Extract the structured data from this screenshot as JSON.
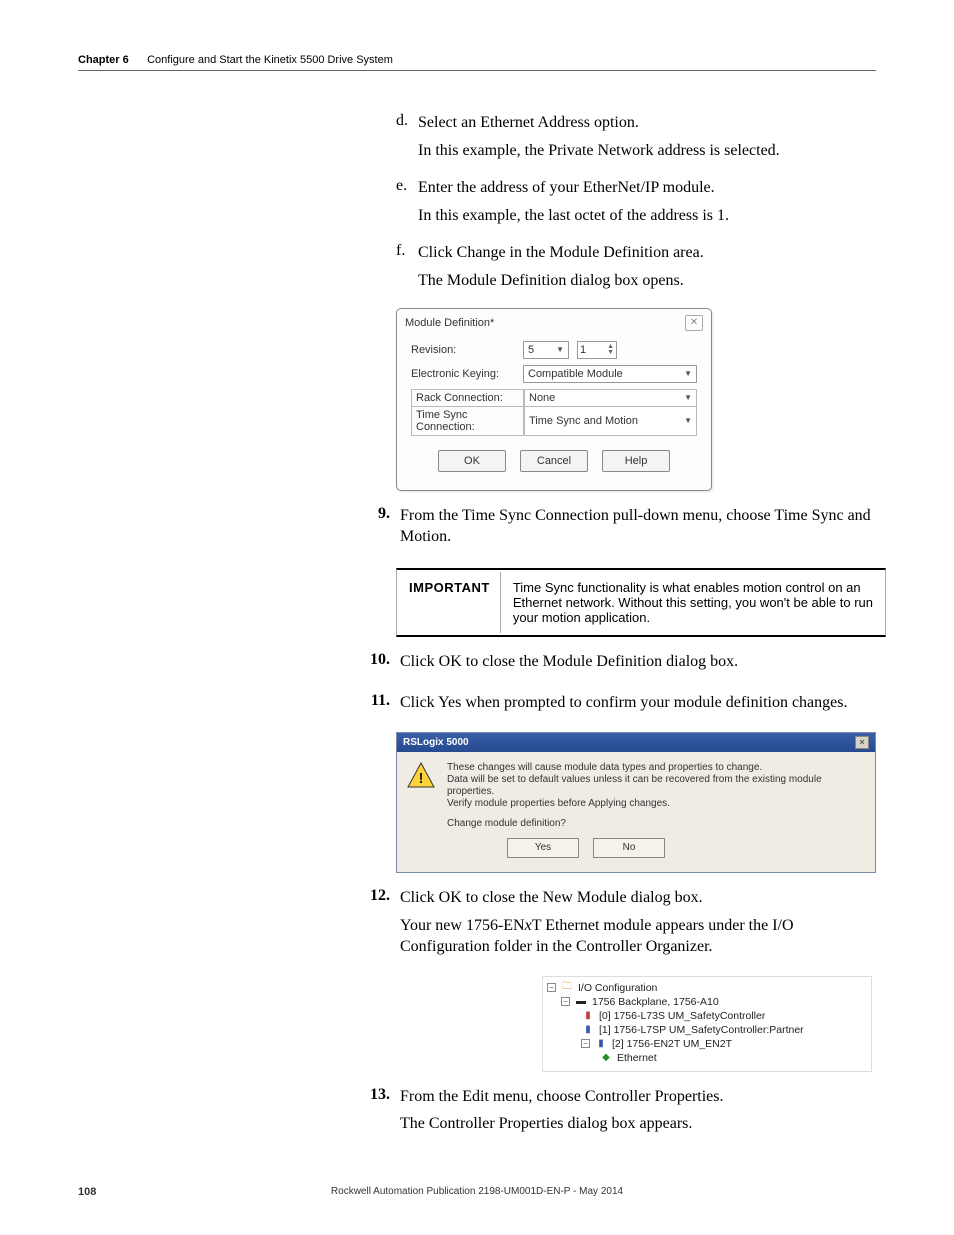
{
  "header": {
    "chapter_label": "Chapter 6",
    "chapter_title": "Configure and Start the Kinetix 5500 Drive System"
  },
  "steps": {
    "d": {
      "letter": "d.",
      "line1": "Select an Ethernet Address option.",
      "line2": "In this example, the Private Network address is selected."
    },
    "e": {
      "letter": "e.",
      "line1": "Enter the address of your EtherNet/IP module.",
      "line2": "In this example, the last octet of the address is 1."
    },
    "f": {
      "letter": "f.",
      "line1": "Click Change in the Module Definition area.",
      "line2": "The Module Definition dialog box opens."
    },
    "s9": {
      "num": "9.",
      "text": "From the Time Sync Connection pull-down menu, choose Time Sync and Motion."
    },
    "s10": {
      "num": "10.",
      "text": "Click OK to close the Module Definition dialog box."
    },
    "s11": {
      "num": "11.",
      "text": "Click Yes when prompted to confirm your module definition changes."
    },
    "s12": {
      "num": "12.",
      "line1": "Click OK to close the New Module dialog box.",
      "line2a": "Your new 1756-EN",
      "line2b": "x",
      "line2c": "T Ethernet module appears under the I/O Configuration folder in the Controller Organizer."
    },
    "s13": {
      "num": "13.",
      "line1": "From the Edit menu, choose Controller Properties.",
      "line2": "The Controller Properties dialog box appears."
    }
  },
  "dlg1": {
    "title": "Module Definition*",
    "labels": {
      "revision": "Revision:",
      "keying": "Electronic Keying:",
      "rack": "Rack Connection:",
      "timesync": "Time Sync Connection:"
    },
    "values": {
      "rev_major": "5",
      "rev_minor": "1",
      "keying": "Compatible Module",
      "rack": "None",
      "timesync": "Time Sync and Motion"
    },
    "buttons": {
      "ok": "OK",
      "cancel": "Cancel",
      "help": "Help"
    }
  },
  "important": {
    "label": "IMPORTANT",
    "text": "Time Sync functionality is what enables motion control on an Ethernet network. Without this setting, you won't be able to run your motion application."
  },
  "dlg2": {
    "title": "RSLogix 5000",
    "line1": "These changes will cause module data types and properties to change.",
    "line2": "Data will be set to default values unless it can be recovered from the existing module properties.",
    "line3": "Verify module properties before Applying changes.",
    "question": "Change module definition?",
    "yes": "Yes",
    "no": "No"
  },
  "tree": {
    "root": "I/O Configuration",
    "backplane": "1756 Backplane, 1756-A10",
    "n0": "[0] 1756-L73S UM_SafetyController",
    "n1": "[1] 1756-L7SP UM_SafetyController:Partner",
    "n2": "[2] 1756-EN2T UM_EN2T",
    "eth": "Ethernet"
  },
  "footer": {
    "page": "108",
    "pub": "Rockwell Automation Publication 2198-UM001D-EN-P - May 2014"
  }
}
